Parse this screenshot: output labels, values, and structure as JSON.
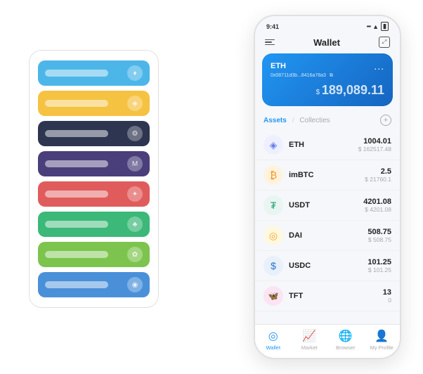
{
  "scene": {
    "background": "#ffffff"
  },
  "card_stack": {
    "cards": [
      {
        "color": "#4db6e8",
        "icon": "♦"
      },
      {
        "color": "#f5c242",
        "icon": "◈"
      },
      {
        "color": "#2d3550",
        "icon": "⚙"
      },
      {
        "color": "#4a3f7a",
        "icon": "M"
      },
      {
        "color": "#e05c5c",
        "icon": "✦"
      },
      {
        "color": "#3cb878",
        "icon": "♣"
      },
      {
        "color": "#7dc44e",
        "icon": "✿"
      },
      {
        "color": "#4a90d9",
        "icon": "◉"
      }
    ]
  },
  "phone": {
    "status_bar": {
      "time": "9:41",
      "signal": "●●●",
      "wifi": "▲",
      "battery": "▮"
    },
    "header": {
      "menu_label": "menu",
      "title": "Wallet",
      "expand_label": "expand"
    },
    "eth_card": {
      "name": "ETH",
      "address": "0x08711d3b...8416a78a3",
      "copy_icon": "⧉",
      "dots": "...",
      "balance_label": "$",
      "balance": "189,089.11"
    },
    "assets_section": {
      "tab_active": "Assets",
      "tab_divider": "/",
      "tab_inactive": "Collecties",
      "add_label": "+"
    },
    "assets": [
      {
        "symbol": "ETH",
        "icon": "◈",
        "icon_color": "#627eea",
        "icon_bg": "#eef0ff",
        "amount": "1004.01",
        "usd": "$ 162517.48"
      },
      {
        "symbol": "imBTC",
        "icon": "₿",
        "icon_color": "#f7931a",
        "icon_bg": "#fff3e0",
        "amount": "2.5",
        "usd": "$ 21760.1"
      },
      {
        "symbol": "USDT",
        "icon": "₮",
        "icon_color": "#26a17b",
        "icon_bg": "#e8f5f1",
        "amount": "4201.08",
        "usd": "$ 4201.08"
      },
      {
        "symbol": "DAI",
        "icon": "◎",
        "icon_color": "#f5a623",
        "icon_bg": "#fff8e1",
        "amount": "508.75",
        "usd": "$ 508.75"
      },
      {
        "symbol": "USDC",
        "icon": "$",
        "icon_color": "#2775ca",
        "icon_bg": "#e8f0fb",
        "amount": "101.25",
        "usd": "$ 101.25"
      },
      {
        "symbol": "TFT",
        "icon": "🦋",
        "icon_color": "#e91e8c",
        "icon_bg": "#fce4f3",
        "amount": "13",
        "usd": "0"
      }
    ],
    "nav": [
      {
        "icon": "◎",
        "label": "Wallet",
        "active": true
      },
      {
        "icon": "📈",
        "label": "Market",
        "active": false
      },
      {
        "icon": "🌐",
        "label": "Browser",
        "active": false
      },
      {
        "icon": "👤",
        "label": "My Profile",
        "active": false
      }
    ]
  }
}
